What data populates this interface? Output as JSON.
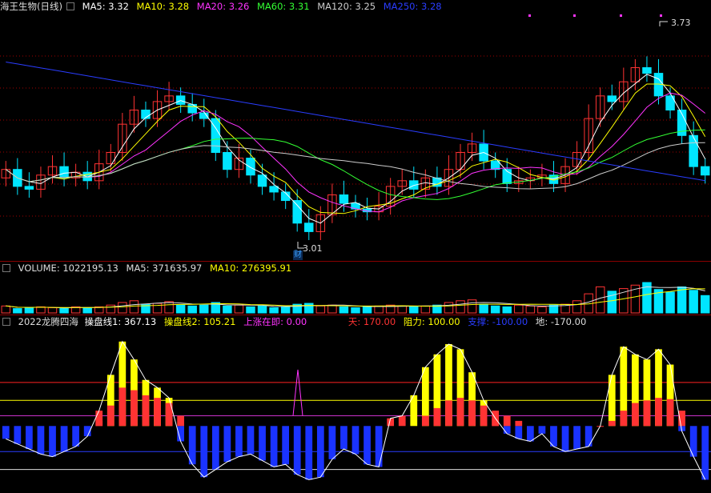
{
  "main": {
    "title": "海王生物(日线)",
    "indicators": [
      {
        "label": "MA5: 3.32",
        "color": "#ffffff"
      },
      {
        "label": "MA10: 3.28",
        "color": "#ffff00"
      },
      {
        "label": "MA20: 3.26",
        "color": "#ff33ff"
      },
      {
        "label": "MA60: 3.31",
        "color": "#33ff33"
      },
      {
        "label": "MA120: 3.25",
        "color": "#cccccc"
      },
      {
        "label": "MA250: 3.28",
        "color": "#2233ff"
      }
    ],
    "high_label": "3.73",
    "low_label": "3.01",
    "finance_badge": "财"
  },
  "volume": {
    "title": "VOLUME: 1022195.13",
    "ma5": "MA5: 371635.97",
    "ma10": "MA10: 276395.91"
  },
  "indicator": {
    "name": "2022龙腾四海",
    "line1": "操盘线1: 367.13",
    "line2": "操盘线2: 105.21",
    "rising": "上涨在即: 0.00",
    "tian": "天: 170.00",
    "zuli": "阻力: 100.00",
    "zhicheng": "支撑: -100.00",
    "di": "地: -170.00"
  },
  "colors": {
    "up": "#ff3333",
    "down": "#00e5ff",
    "bear": "#1a33ff",
    "bull": "#ffff00",
    "grid_red": "#a00000"
  },
  "chart_data": [
    {
      "type": "candlestick",
      "title": "海王生物(日线)",
      "price_high": 3.73,
      "price_low": 3.01,
      "close": [
        3.24,
        3.18,
        3.17,
        3.22,
        3.25,
        3.21,
        3.23,
        3.2,
        3.26,
        3.3,
        3.4,
        3.45,
        3.42,
        3.48,
        3.5,
        3.47,
        3.44,
        3.42,
        3.3,
        3.24,
        3.28,
        3.22,
        3.18,
        3.16,
        3.13,
        3.05,
        3.02,
        3.08,
        3.15,
        3.12,
        3.1,
        3.09,
        3.11,
        3.18,
        3.2,
        3.17,
        3.21,
        3.18,
        3.24,
        3.3,
        3.33,
        3.27,
        3.24,
        3.19,
        3.2,
        3.21,
        3.22,
        3.19,
        3.25,
        3.3,
        3.42,
        3.5,
        3.48,
        3.55,
        3.6,
        3.58,
        3.5,
        3.45,
        3.36,
        3.25,
        3.22
      ]
    },
    {
      "type": "bar",
      "title": "VOLUME",
      "series": [
        {
          "name": "VOLUME",
          "values": [
            8,
            5,
            6,
            7,
            6,
            5,
            7,
            6,
            7,
            9,
            12,
            14,
            10,
            11,
            13,
            9,
            8,
            9,
            12,
            8,
            9,
            7,
            8,
            6,
            7,
            10,
            11,
            8,
            9,
            7,
            6,
            7,
            8,
            9,
            8,
            7,
            8,
            9,
            12,
            14,
            15,
            10,
            8,
            7,
            9,
            8,
            7,
            9,
            10,
            14,
            22,
            30,
            25,
            28,
            32,
            35,
            27,
            24,
            30,
            26,
            20
          ]
        },
        {
          "name": "MA5",
          "values": []
        },
        {
          "name": "MA10",
          "values": []
        }
      ]
    },
    {
      "type": "bar",
      "title": "2022龙腾四海",
      "reference_lines": {
        "天": 170,
        "阻力": 100,
        "支撑": -100,
        "地": -170
      },
      "series": [
        {
          "name": "操盘线1",
          "values": [
            -50,
            -70,
            -90,
            -110,
            -120,
            -100,
            -80,
            -40,
            60,
            200,
            330,
            260,
            180,
            150,
            110,
            -60,
            -150,
            -200,
            -170,
            -140,
            -120,
            -110,
            -135,
            -160,
            -150,
            -190,
            -210,
            -200,
            -130,
            -90,
            -110,
            -150,
            -160,
            30,
            40,
            120,
            230,
            280,
            320,
            300,
            210,
            100,
            30,
            -30,
            -50,
            -60,
            -30,
            -80,
            -100,
            -90,
            -80,
            0,
            200,
            310,
            280,
            260,
            300,
            240,
            -20,
            -120,
            -210
          ]
        },
        {
          "name": "操盘线2",
          "values": [
            -40,
            -50,
            -60,
            -70,
            -80,
            -70,
            -50,
            -20,
            20,
            80,
            150,
            140,
            120,
            110,
            90,
            40,
            -20,
            -60,
            -80,
            -90,
            -95,
            -100,
            -105,
            -110,
            -115,
            -120,
            -125,
            -120,
            -110,
            -100,
            -95,
            -95,
            -100,
            -60,
            -40,
            0,
            40,
            70,
            100,
            110,
            100,
            80,
            60,
            40,
            20,
            0,
            -10,
            -20,
            -30,
            -40,
            -40,
            -20,
            20,
            60,
            90,
            100,
            110,
            105,
            60,
            0,
            -60
          ]
        },
        {
          "name": "上涨在即",
          "values": [
            0
          ]
        }
      ]
    }
  ]
}
